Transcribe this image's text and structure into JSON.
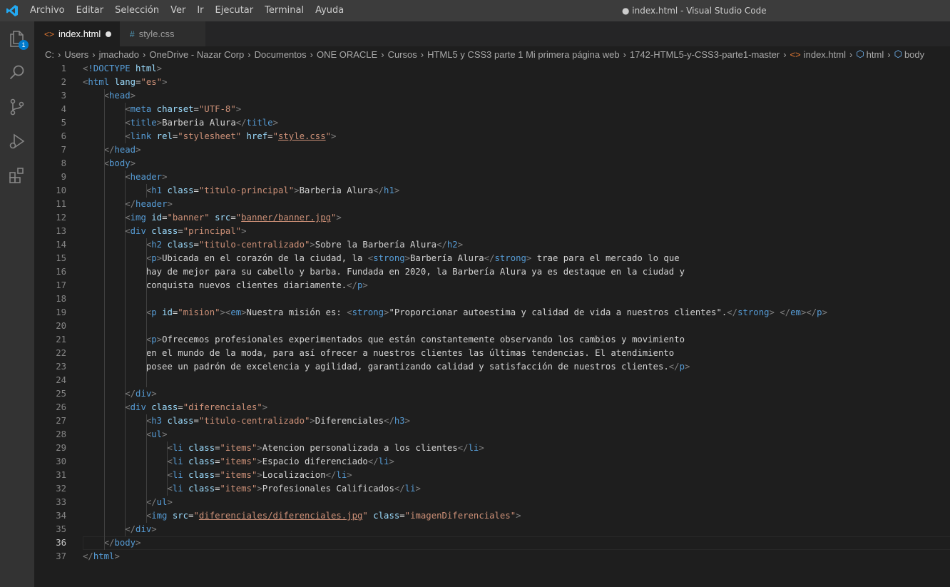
{
  "window": {
    "title": "● index.html - Visual Studio Code"
  },
  "menu": [
    "Archivo",
    "Editar",
    "Selección",
    "Ver",
    "Ir",
    "Ejecutar",
    "Terminal",
    "Ayuda"
  ],
  "activity": {
    "explorer_badge": "1"
  },
  "tabs": [
    {
      "label": "index.html",
      "icon": "html-file-icon",
      "active": true,
      "dirty": true
    },
    {
      "label": "style.css",
      "icon": "css-file-icon",
      "active": false
    }
  ],
  "breadcrumbs": [
    "C:",
    "Users",
    "jmachado",
    "OneDrive - Nazar Corp",
    "Documentos",
    "ONE ORACLE",
    "Cursos",
    "HTML5 y CSS3 parte 1 Mi primera página web",
    "1742-HTML5-y-CSS3-parte1-master",
    "index.html",
    "html",
    "body"
  ],
  "editor": {
    "active_line": 36,
    "lines": [
      [
        [
          "t",
          "<"
        ],
        [
          "n",
          "!DOCTYPE"
        ],
        [
          "x",
          " "
        ],
        [
          "a",
          "html"
        ],
        [
          "t",
          ">"
        ]
      ],
      [
        [
          "t",
          "<"
        ],
        [
          "n",
          "html"
        ],
        [
          "x",
          " "
        ],
        [
          "a",
          "lang"
        ],
        [
          "x",
          "="
        ],
        [
          "s",
          "\"es\""
        ],
        [
          "t",
          ">"
        ]
      ],
      [
        [
          "x",
          "    "
        ],
        [
          "t",
          "<"
        ],
        [
          "n",
          "head"
        ],
        [
          "t",
          ">"
        ]
      ],
      [
        [
          "x",
          "        "
        ],
        [
          "t",
          "<"
        ],
        [
          "n",
          "meta"
        ],
        [
          "x",
          " "
        ],
        [
          "a",
          "charset"
        ],
        [
          "x",
          "="
        ],
        [
          "s",
          "\"UTF-8\""
        ],
        [
          "t",
          ">"
        ]
      ],
      [
        [
          "x",
          "        "
        ],
        [
          "t",
          "<"
        ],
        [
          "n",
          "title"
        ],
        [
          "t",
          ">"
        ],
        [
          "x",
          "Barberia Alura"
        ],
        [
          "t",
          "</"
        ],
        [
          "n",
          "title"
        ],
        [
          "t",
          ">"
        ]
      ],
      [
        [
          "x",
          "        "
        ],
        [
          "t",
          "<"
        ],
        [
          "n",
          "link"
        ],
        [
          "x",
          " "
        ],
        [
          "a",
          "rel"
        ],
        [
          "x",
          "="
        ],
        [
          "s",
          "\"stylesheet\""
        ],
        [
          "x",
          " "
        ],
        [
          "a",
          "href"
        ],
        [
          "x",
          "="
        ],
        [
          "s",
          "\""
        ],
        [
          "su",
          "style.css"
        ],
        [
          "s",
          "\""
        ],
        [
          "t",
          ">"
        ]
      ],
      [
        [
          "x",
          "    "
        ],
        [
          "t",
          "</"
        ],
        [
          "n",
          "head"
        ],
        [
          "t",
          ">"
        ]
      ],
      [
        [
          "x",
          "    "
        ],
        [
          "t",
          "<"
        ],
        [
          "n",
          "body"
        ],
        [
          "t",
          ">"
        ]
      ],
      [
        [
          "x",
          "        "
        ],
        [
          "t",
          "<"
        ],
        [
          "n",
          "header"
        ],
        [
          "t",
          ">"
        ]
      ],
      [
        [
          "x",
          "            "
        ],
        [
          "t",
          "<"
        ],
        [
          "n",
          "h1"
        ],
        [
          "x",
          " "
        ],
        [
          "a",
          "class"
        ],
        [
          "x",
          "="
        ],
        [
          "s",
          "\"titulo-principal\""
        ],
        [
          "t",
          ">"
        ],
        [
          "x",
          "Barberia Alura"
        ],
        [
          "t",
          "</"
        ],
        [
          "n",
          "h1"
        ],
        [
          "t",
          ">"
        ]
      ],
      [
        [
          "x",
          "        "
        ],
        [
          "t",
          "</"
        ],
        [
          "n",
          "header"
        ],
        [
          "t",
          ">"
        ]
      ],
      [
        [
          "x",
          "        "
        ],
        [
          "t",
          "<"
        ],
        [
          "n",
          "img"
        ],
        [
          "x",
          " "
        ],
        [
          "a",
          "id"
        ],
        [
          "x",
          "="
        ],
        [
          "s",
          "\"banner\""
        ],
        [
          "x",
          " "
        ],
        [
          "a",
          "src"
        ],
        [
          "x",
          "="
        ],
        [
          "s",
          "\""
        ],
        [
          "su",
          "banner/banner.jpg"
        ],
        [
          "s",
          "\""
        ],
        [
          "t",
          ">"
        ]
      ],
      [
        [
          "x",
          "        "
        ],
        [
          "t",
          "<"
        ],
        [
          "n",
          "div"
        ],
        [
          "x",
          " "
        ],
        [
          "a",
          "class"
        ],
        [
          "x",
          "="
        ],
        [
          "s",
          "\"principal\""
        ],
        [
          "t",
          ">"
        ]
      ],
      [
        [
          "x",
          "            "
        ],
        [
          "t",
          "<"
        ],
        [
          "n",
          "h2"
        ],
        [
          "x",
          " "
        ],
        [
          "a",
          "class"
        ],
        [
          "x",
          "="
        ],
        [
          "s",
          "\"titulo-centralizado\""
        ],
        [
          "t",
          ">"
        ],
        [
          "x",
          "Sobre la Barbería Alura"
        ],
        [
          "t",
          "</"
        ],
        [
          "n",
          "h2"
        ],
        [
          "t",
          ">"
        ]
      ],
      [
        [
          "x",
          "            "
        ],
        [
          "t",
          "<"
        ],
        [
          "n",
          "p"
        ],
        [
          "t",
          ">"
        ],
        [
          "x",
          "Ubicada en el corazón de la ciudad, la "
        ],
        [
          "t",
          "<"
        ],
        [
          "n",
          "strong"
        ],
        [
          "t",
          ">"
        ],
        [
          "x",
          "Barbería Alura"
        ],
        [
          "t",
          "</"
        ],
        [
          "n",
          "strong"
        ],
        [
          "t",
          ">"
        ],
        [
          "x",
          " trae para el mercado lo que"
        ]
      ],
      [
        [
          "x",
          "            hay de mejor para su cabello y barba. Fundada en 2020, la Barbería Alura ya es destaque en la ciudad y"
        ]
      ],
      [
        [
          "x",
          "            conquista nuevos clientes diariamente."
        ],
        [
          "t",
          "</"
        ],
        [
          "n",
          "p"
        ],
        [
          "t",
          ">"
        ]
      ],
      [
        [
          "x",
          ""
        ]
      ],
      [
        [
          "x",
          "            "
        ],
        [
          "t",
          "<"
        ],
        [
          "n",
          "p"
        ],
        [
          "x",
          " "
        ],
        [
          "a",
          "id"
        ],
        [
          "x",
          "="
        ],
        [
          "s",
          "\"mision\""
        ],
        [
          "t",
          ">"
        ],
        [
          "t",
          "<"
        ],
        [
          "n",
          "em"
        ],
        [
          "t",
          ">"
        ],
        [
          "x",
          "Nuestra misión es: "
        ],
        [
          "t",
          "<"
        ],
        [
          "n",
          "strong"
        ],
        [
          "t",
          ">"
        ],
        [
          "x",
          "\"Proporcionar autoestima y calidad de vida a nuestros clientes\"."
        ],
        [
          "t",
          "</"
        ],
        [
          "n",
          "strong"
        ],
        [
          "t",
          ">"
        ],
        [
          "x",
          " "
        ],
        [
          "t",
          "</"
        ],
        [
          "n",
          "em"
        ],
        [
          "t",
          ">"
        ],
        [
          "t",
          "</"
        ],
        [
          "n",
          "p"
        ],
        [
          "t",
          ">"
        ]
      ],
      [
        [
          "x",
          ""
        ]
      ],
      [
        [
          "x",
          "            "
        ],
        [
          "t",
          "<"
        ],
        [
          "n",
          "p"
        ],
        [
          "t",
          ">"
        ],
        [
          "x",
          "Ofrecemos profesionales experimentados que están constantemente observando los cambios y movimiento"
        ]
      ],
      [
        [
          "x",
          "            en el mundo de la moda, para así ofrecer a nuestros clientes las últimas tendencias. El atendimiento"
        ]
      ],
      [
        [
          "x",
          "            posee un padrón de excelencia y agilidad, garantizando calidad y satisfacción de nuestros clientes."
        ],
        [
          "t",
          "</"
        ],
        [
          "n",
          "p"
        ],
        [
          "t",
          ">"
        ]
      ],
      [
        [
          "x",
          ""
        ]
      ],
      [
        [
          "x",
          "        "
        ],
        [
          "t",
          "</"
        ],
        [
          "n",
          "div"
        ],
        [
          "t",
          ">"
        ]
      ],
      [
        [
          "x",
          "        "
        ],
        [
          "t",
          "<"
        ],
        [
          "n",
          "div"
        ],
        [
          "x",
          " "
        ],
        [
          "a",
          "class"
        ],
        [
          "x",
          "="
        ],
        [
          "s",
          "\"diferenciales\""
        ],
        [
          "t",
          ">"
        ]
      ],
      [
        [
          "x",
          "            "
        ],
        [
          "t",
          "<"
        ],
        [
          "n",
          "h3"
        ],
        [
          "x",
          " "
        ],
        [
          "a",
          "class"
        ],
        [
          "x",
          "="
        ],
        [
          "s",
          "\"titulo-centralizado\""
        ],
        [
          "t",
          ">"
        ],
        [
          "x",
          "Diferenciales"
        ],
        [
          "t",
          "</"
        ],
        [
          "n",
          "h3"
        ],
        [
          "t",
          ">"
        ]
      ],
      [
        [
          "x",
          "            "
        ],
        [
          "t",
          "<"
        ],
        [
          "n",
          "ul"
        ],
        [
          "t",
          ">"
        ]
      ],
      [
        [
          "x",
          "                "
        ],
        [
          "t",
          "<"
        ],
        [
          "n",
          "li"
        ],
        [
          "x",
          " "
        ],
        [
          "a",
          "class"
        ],
        [
          "x",
          "="
        ],
        [
          "s",
          "\"items\""
        ],
        [
          "t",
          ">"
        ],
        [
          "x",
          "Atencion personalizada a los clientes"
        ],
        [
          "t",
          "</"
        ],
        [
          "n",
          "li"
        ],
        [
          "t",
          ">"
        ]
      ],
      [
        [
          "x",
          "                "
        ],
        [
          "t",
          "<"
        ],
        [
          "n",
          "li"
        ],
        [
          "x",
          " "
        ],
        [
          "a",
          "class"
        ],
        [
          "x",
          "="
        ],
        [
          "s",
          "\"items\""
        ],
        [
          "t",
          ">"
        ],
        [
          "x",
          "Espacio diferenciado"
        ],
        [
          "t",
          "</"
        ],
        [
          "n",
          "li"
        ],
        [
          "t",
          ">"
        ]
      ],
      [
        [
          "x",
          "                "
        ],
        [
          "t",
          "<"
        ],
        [
          "n",
          "li"
        ],
        [
          "x",
          " "
        ],
        [
          "a",
          "class"
        ],
        [
          "x",
          "="
        ],
        [
          "s",
          "\"items\""
        ],
        [
          "t",
          ">"
        ],
        [
          "x",
          "Localizacion"
        ],
        [
          "t",
          "</"
        ],
        [
          "n",
          "li"
        ],
        [
          "t",
          ">"
        ]
      ],
      [
        [
          "x",
          "                "
        ],
        [
          "t",
          "<"
        ],
        [
          "n",
          "li"
        ],
        [
          "x",
          " "
        ],
        [
          "a",
          "class"
        ],
        [
          "x",
          "="
        ],
        [
          "s",
          "\"items\""
        ],
        [
          "t",
          ">"
        ],
        [
          "x",
          "Profesionales Calificados"
        ],
        [
          "t",
          "</"
        ],
        [
          "n",
          "li"
        ],
        [
          "t",
          ">"
        ]
      ],
      [
        [
          "x",
          "            "
        ],
        [
          "t",
          "</"
        ],
        [
          "n",
          "ul"
        ],
        [
          "t",
          ">"
        ]
      ],
      [
        [
          "x",
          "            "
        ],
        [
          "t",
          "<"
        ],
        [
          "n",
          "img"
        ],
        [
          "x",
          " "
        ],
        [
          "a",
          "src"
        ],
        [
          "x",
          "="
        ],
        [
          "s",
          "\""
        ],
        [
          "su",
          "diferenciales/diferenciales.jpg"
        ],
        [
          "s",
          "\""
        ],
        [
          "x",
          " "
        ],
        [
          "a",
          "class"
        ],
        [
          "x",
          "="
        ],
        [
          "s",
          "\"imagenDiferenciales\""
        ],
        [
          "t",
          ">"
        ]
      ],
      [
        [
          "x",
          "        "
        ],
        [
          "t",
          "</"
        ],
        [
          "n",
          "div"
        ],
        [
          "t",
          ">"
        ]
      ],
      [
        [
          "x",
          "    "
        ],
        [
          "t",
          "</"
        ],
        [
          "n",
          "body"
        ],
        [
          "t",
          ">"
        ]
      ],
      [
        [
          "t",
          "</"
        ],
        [
          "n",
          "html"
        ],
        [
          "t",
          ">"
        ]
      ]
    ]
  },
  "colors": {
    "accent": "#007acc",
    "tag": "#569cd6",
    "attr": "#9cdcfe",
    "string": "#ce9178",
    "bracket": "#808080"
  }
}
